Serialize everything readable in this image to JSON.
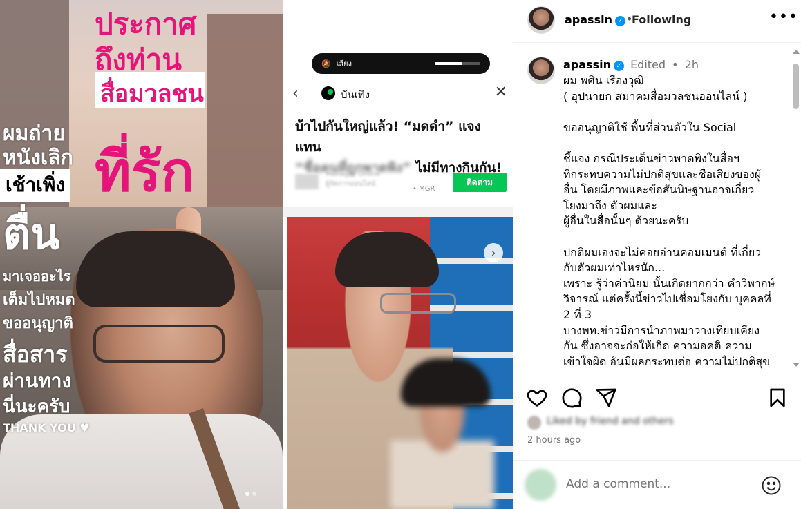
{
  "story": {
    "title_line1": "ประกาศ",
    "title_line2": "ถึงท่าน",
    "title_box": "สื่อมวลชน",
    "title_big": "ที่รัก",
    "left_line1": "ผมถ่าย",
    "left_line2": "หนังเลิก",
    "left_box": "เช้าเพิ่ง",
    "left_big": "ตื่น",
    "left_line3": "มาเจออะไร",
    "left_line4": "เต็มไปหมด",
    "left_line5": "ขออนุญาติ",
    "left_line6": "สื่อสาร",
    "left_line7": "ผ่านทาง",
    "left_line8": "นี่นะครับ",
    "thank_you": "THANK YOU ♥"
  },
  "news": {
    "pill_label": "เสียง",
    "source_name": "บันเทิง",
    "headline_part1": "บ้าไปกันใหญ่แล้ว! “มดดำ” แจงแทน",
    "headline_blurred": "“ชื่อคนที่ถูกพาดพิง”",
    "headline_part2": " ไม่มีทางกินกัน!",
    "publisher_blurred": "Manager Online",
    "publisher_sub_blurred": "ผู้จัดการออนไลน์",
    "publisher_tag": "• MGR",
    "follow_label": "ติดตาม"
  },
  "panel": {
    "username": "apassin",
    "following": "Following",
    "comment": {
      "username": "apassin",
      "edited": "Edited",
      "time": "2h",
      "text": "ผม พศิน เรืองวุฒิ\n( อุปนายก สมาคมสื่อมวลชนออนไลน์ )\n\nขออนุญาติใช้ พื้นที่ส่วนตัวใน Social\n\nชี้แจง กรณีประเด็นข่าวพาดพิงในสื่อฯ\nที่กระทบความไม่ปกติสุขและชื่อเสียงของผู้\nอื่น โดยมีภาพและข้อสันนิษฐานอาจเกี่ยว\nโยงมาถึง ตัวผมและ\nผู้อื่นในสื่อนั้นๆ ด้วยนะครับ\n\nปกติผมเองจะไม่ค่อยอ่านคอมเมนต์ ที่เกี่ยว\nกับตัวผมเท่าไหร่นัก...\nเพราะ รู้ว่าค่านิยม นั้นเกิดยากกว่า คำวิพากษ์\nวิจารณ์ แต่ครั้งนี้ข่าวไปเชื่อมโยงกับ บุคคลที่\n2 ที่ 3\nบางพท.ข่าวมีการนำภาพมาวางเทียบเคียง\nกัน ซึ่งอาจจะก่อให้เกิด ความอคติ ความ\nเข้าใจผิด อันมีผลกระทบต่อ ความไม่ปกติสุข"
    },
    "likes_blurred": "Liked by friend and others",
    "timestamp": "2 hours ago",
    "add_comment_placeholder": "Add a comment..."
  },
  "icons": [
    "heart-icon",
    "comment-icon",
    "share-icon",
    "save-icon",
    "emoji-icon",
    "more-icon",
    "verified-icon",
    "back-icon",
    "close-icon",
    "next-icon"
  ],
  "colors": {
    "story_pink": "#e5147a",
    "line_green": "#06c755",
    "verified_blue": "#0095f6",
    "muted_text": "#737373"
  }
}
